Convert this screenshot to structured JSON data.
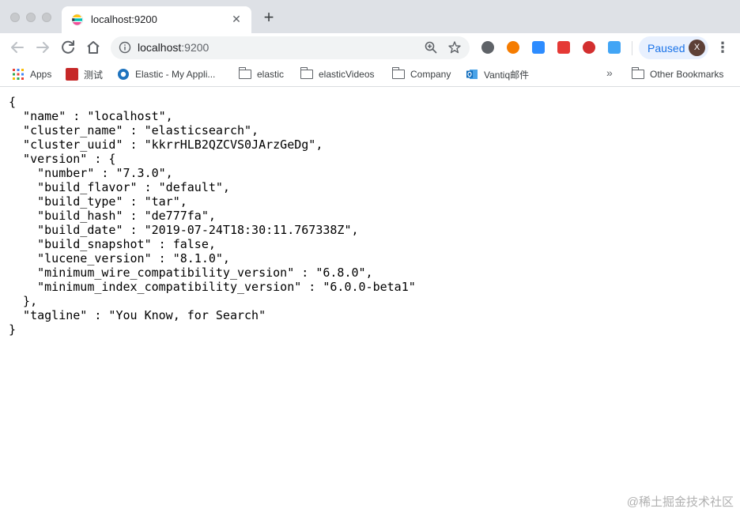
{
  "window": {
    "tab": {
      "title": "localhost:9200"
    }
  },
  "toolbar": {
    "url_host": "localhost",
    "url_port": ":9200",
    "profile_status": "Paused",
    "profile_initial": "X"
  },
  "bookmarks": {
    "items": [
      {
        "label": "Apps",
        "icon": "apps-grid-icon"
      },
      {
        "label": "测试",
        "icon": "favicon-red-icon"
      },
      {
        "label": "Elastic - My Appli...",
        "icon": "elastic-icon"
      },
      {
        "label": "elastic",
        "icon": "folder-icon"
      },
      {
        "label": "elasticVideos",
        "icon": "folder-icon"
      },
      {
        "label": "Company",
        "icon": "folder-icon"
      },
      {
        "label": "Vantiq邮件",
        "icon": "outlook-icon"
      }
    ],
    "overflow": "»",
    "other": "Other Bookmarks"
  },
  "page": {
    "json_text": "{\n  \"name\" : \"localhost\",\n  \"cluster_name\" : \"elasticsearch\",\n  \"cluster_uuid\" : \"kkrrHLB2QZCVS0JArzGeDg\",\n  \"version\" : {\n    \"number\" : \"7.3.0\",\n    \"build_flavor\" : \"default\",\n    \"build_type\" : \"tar\",\n    \"build_hash\" : \"de777fa\",\n    \"build_date\" : \"2019-07-24T18:30:11.767338Z\",\n    \"build_snapshot\" : false,\n    \"lucene_version\" : \"8.1.0\",\n    \"minimum_wire_compatibility_version\" : \"6.8.0\",\n    \"minimum_index_compatibility_version\" : \"6.0.0-beta1\"\n  },\n  \"tagline\" : \"You Know, for Search\"\n}",
    "watermark": "@稀土掘金技术社区"
  },
  "colors": {
    "tabstrip": "#dee1e6",
    "omnibox": "#f1f3f4",
    "paused_bg": "#e8f0fe",
    "paused_text": "#1a73e8"
  }
}
